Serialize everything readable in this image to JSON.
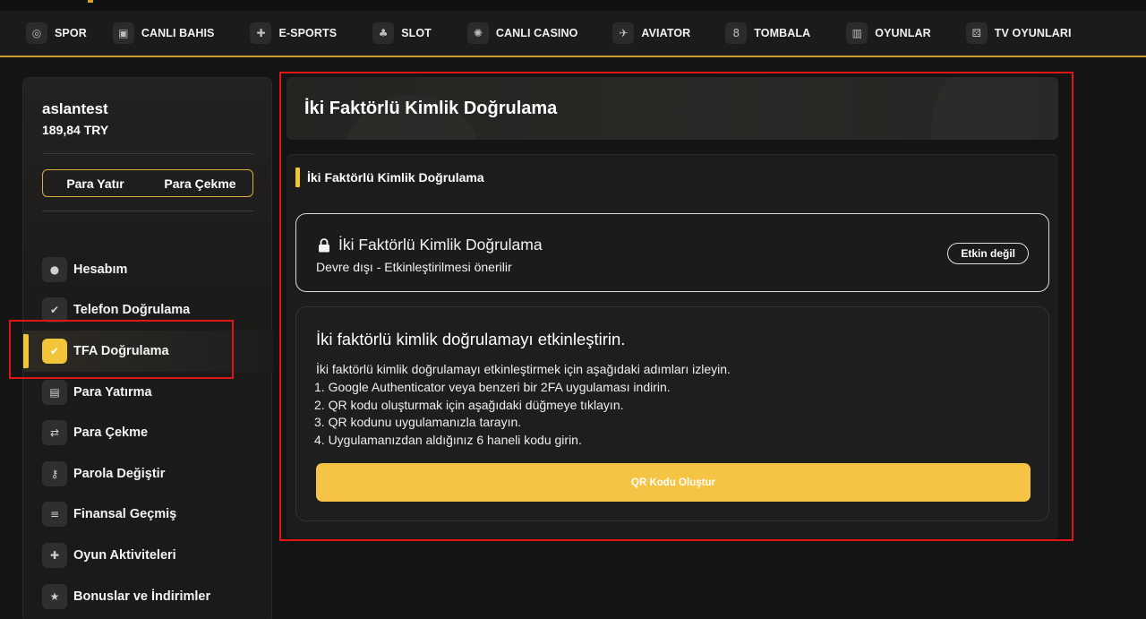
{
  "nav": {
    "items": [
      {
        "label": "SPOR",
        "icon": "basketball-icon",
        "glyph": "◎"
      },
      {
        "label": "CANLI BAHIS",
        "icon": "live-tv-icon",
        "glyph": "▣"
      },
      {
        "label": "E-SPORTS",
        "icon": "gamepad-icon",
        "glyph": "✚"
      },
      {
        "label": "SLOT",
        "icon": "cherry-icon",
        "glyph": "♣"
      },
      {
        "label": "CANLI CASINO",
        "icon": "casino-chip-icon",
        "glyph": "✺"
      },
      {
        "label": "AVIATOR",
        "icon": "airplane-icon",
        "glyph": "✈"
      },
      {
        "label": "TOMBALA",
        "icon": "bingo-ball-icon",
        "glyph": "8"
      },
      {
        "label": "OYUNLAR",
        "icon": "bar-chart-icon",
        "glyph": "▥"
      },
      {
        "label": "TV OYUNLARI",
        "icon": "dice-icon",
        "glyph": "⚄"
      }
    ]
  },
  "account": {
    "username": "aslantest",
    "balance": "189,84 TRY",
    "deposit_label": "Para Yatır",
    "withdraw_label": "Para Çekme"
  },
  "sidebar": {
    "items": [
      {
        "label": "Hesabım",
        "icon": "user-icon",
        "glyph": "●"
      },
      {
        "label": "Telefon Doğrulama",
        "icon": "verified-badge-icon",
        "glyph": "✔"
      },
      {
        "label": "TFA Doğrulama",
        "icon": "check-circle-icon",
        "glyph": "✔",
        "active": true
      },
      {
        "label": "Para Yatırma",
        "icon": "wallet-icon",
        "glyph": "▤"
      },
      {
        "label": "Para Çekme",
        "icon": "exchange-icon",
        "glyph": "⇄"
      },
      {
        "label": "Parola Değiştir",
        "icon": "key-icon",
        "glyph": "⚷"
      },
      {
        "label": "Finansal Geçmiş",
        "icon": "coins-icon",
        "glyph": "≡"
      },
      {
        "label": "Oyun Aktiviteleri",
        "icon": "gamepad-icon",
        "glyph": "✚"
      },
      {
        "label": "Bonuslar ve İndirimler",
        "icon": "star-icon",
        "glyph": "★"
      }
    ]
  },
  "main": {
    "page_title": "İki Faktörlü Kimlik Doğrulama",
    "section_title": "İki Faktörlü Kimlik Doğrulama",
    "status": {
      "title": "İki Faktörlü Kimlik Doğrulama",
      "subtitle": "Devre dışı - Etkinleştirilmesi önerilir",
      "badge": "Etkin değil",
      "icon": "lock-icon"
    },
    "setup": {
      "title": "İki faktörlü kimlik doğrulamayı etkinleştirin.",
      "intro": "İki faktörlü kimlik doğrulamayı etkinleştirmek için aşağıdaki adımları izleyin.",
      "steps": [
        "1. Google Authenticator veya benzeri bir 2FA uygulaması indirin.",
        "2. QR kodu oluşturmak için aşağıdaki düğmeye tıklayın.",
        "3. QR kodunu uygulamanızla tarayın.",
        "4. Uygulamanızdan aldığınız 6 haneli kodu girin."
      ],
      "button_label": "QR Kodu Oluştur"
    }
  },
  "colors": {
    "accent": "#f2c43a",
    "button": "#f5c444",
    "highlight": "#e11515",
    "background": "#141414"
  }
}
